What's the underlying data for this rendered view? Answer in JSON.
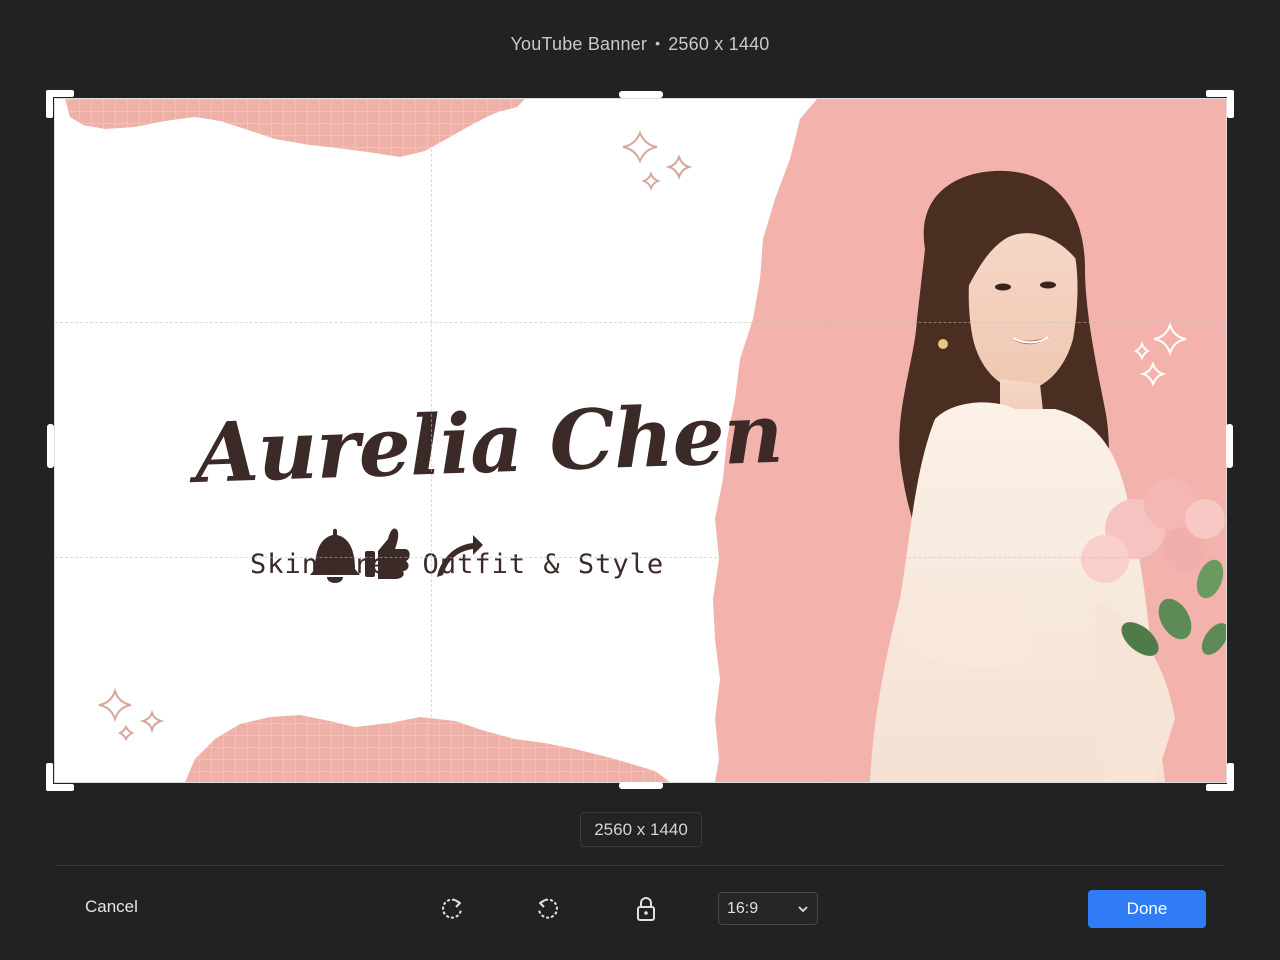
{
  "header": {
    "title": "YouTube Banner",
    "separator": "•",
    "dimensions": "2560 x 1440"
  },
  "banner": {
    "name": "Aurelia Chen",
    "tagline": "Skincare, Outfit & Style",
    "icons": [
      "bell-icon",
      "thumbs-up-icon",
      "share-arrow-icon"
    ],
    "colors": {
      "pink": "#f3b3ac",
      "paper_pink": "#eeb1a8",
      "text_brown": "#3c2a28",
      "sparkle": "#d7a79b"
    }
  },
  "size_label": "2560 x 1440",
  "toolbar": {
    "cancel_label": "Cancel",
    "rotate_clockwise_icon": "rotate-clockwise-icon",
    "rotate_counterclockwise_icon": "rotate-counterclockwise-icon",
    "lock_icon": "lock-icon",
    "aspect_ratio": "16:9",
    "done_label": "Done",
    "accent": "#2f7cf6"
  }
}
